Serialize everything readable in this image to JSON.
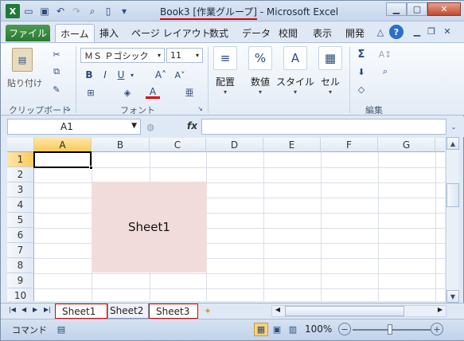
{
  "titlebar": {
    "book": "Book3 [作業グループ]",
    "app": " - Microsoft Excel"
  },
  "qat": {
    "app_icon": "X"
  },
  "ribbon_tabs": {
    "file": "ファイル",
    "items": [
      "ホーム",
      "挿入",
      "ページ レイアウト",
      "数式",
      "データ",
      "校閲",
      "表示",
      "開発"
    ]
  },
  "ribbon": {
    "paste_label": "貼り付け",
    "clipboard_label": "クリップボード",
    "font_name": "ＭＳ Ｐゴシック",
    "font_size": "11",
    "font_label": "フォント",
    "align_label": "配置",
    "number_label": "数値",
    "style_label": "スタイル",
    "cell_label": "セル",
    "edit_label": "編集",
    "sigma": "Σ"
  },
  "formula_bar": {
    "name_box": "A1",
    "fx": "fx",
    "content": ""
  },
  "grid": {
    "columns": [
      "A",
      "B",
      "C",
      "D",
      "E",
      "F",
      "G"
    ],
    "rows": [
      "1",
      "2",
      "3",
      "4",
      "5",
      "6",
      "7",
      "8",
      "9",
      "10"
    ],
    "cell_text": "Sheet1",
    "fill_color": "#f2dcdb"
  },
  "sheets": {
    "tabs": [
      "Sheet1",
      "Sheet2",
      "Sheet3"
    ],
    "highlight_color": "#e00000"
  },
  "status": {
    "mode": "コマンド",
    "zoom": "100%"
  }
}
